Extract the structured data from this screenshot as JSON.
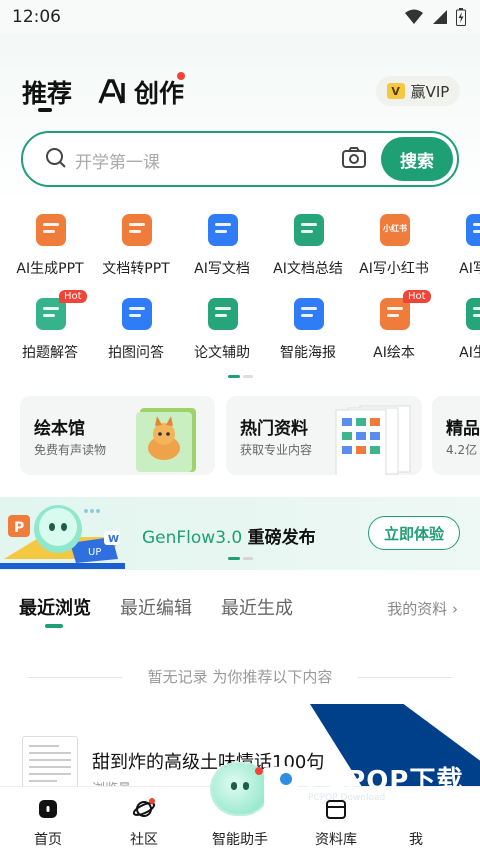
{
  "status_bar": {
    "time": "12:06"
  },
  "header": {
    "tab_recommend": "推荐",
    "tab_create": "创作",
    "vip_label": "赢VIP",
    "vip_badge": "V"
  },
  "search": {
    "placeholder": "开学第一课",
    "button": "搜索"
  },
  "tools": [
    {
      "label": "AI生成PPT",
      "icon": "ppt-icon",
      "color": "#f07c3b"
    },
    {
      "label": "文档转PPT",
      "icon": "ppt-convert-icon",
      "color": "#f07c3b"
    },
    {
      "label": "AI写文档",
      "icon": "doc-write-icon",
      "color": "#2f7cf6"
    },
    {
      "label": "AI文档总结",
      "icon": "doc-summary-icon",
      "color": "#27a57a"
    },
    {
      "label": "AI写小红书",
      "icon": "xiaohongshu-icon",
      "color": "#f07c3b",
      "icon_text": "小红书"
    },
    {
      "label": "AI写作",
      "icon": "writing-icon",
      "color": "#2f7cf6"
    },
    {
      "label": "拍题解答",
      "icon": "photo-question-icon",
      "color": "#36b38a",
      "hot": "Hot"
    },
    {
      "label": "拍图问答",
      "icon": "camera-qa-icon",
      "color": "#2f7cf6"
    },
    {
      "label": "论文辅助",
      "icon": "graduation-cap-icon",
      "color": "#27a57a"
    },
    {
      "label": "智能海报",
      "icon": "poster-icon",
      "color": "#2f7cf6"
    },
    {
      "label": "AI绘本",
      "icon": "picture-book-icon",
      "color": "#f07c3b",
      "hot": "Hot"
    },
    {
      "label": "AI生图",
      "icon": "image-gen-icon",
      "color": "#27a57a"
    }
  ],
  "cards": [
    {
      "title": "绘本馆",
      "subtitle": "免费有声读物"
    },
    {
      "title": "热门资料",
      "subtitle": "获取专业内容"
    },
    {
      "title": "精品",
      "subtitle": "4.2亿"
    }
  ],
  "banner": {
    "product": "GenFlow3.0",
    "headline": "重磅发布",
    "button": "立即体验",
    "card_letter": "P",
    "card_up": "UP",
    "card_w": "W"
  },
  "recent": {
    "tabs": [
      "最近浏览",
      "最近编辑",
      "最近生成"
    ],
    "my_docs": "我的资料",
    "empty_text": "暂无记录 为你推荐以下内容",
    "doc_title": "甜到炸的高级土味情话100句",
    "doc_sub": "浏览量"
  },
  "watermark": {
    "text": "PCPOP下载",
    "sub": "PCPOP Download"
  },
  "nav": {
    "items": [
      "首页",
      "社区",
      "智能助手",
      "资料库",
      "我"
    ]
  }
}
